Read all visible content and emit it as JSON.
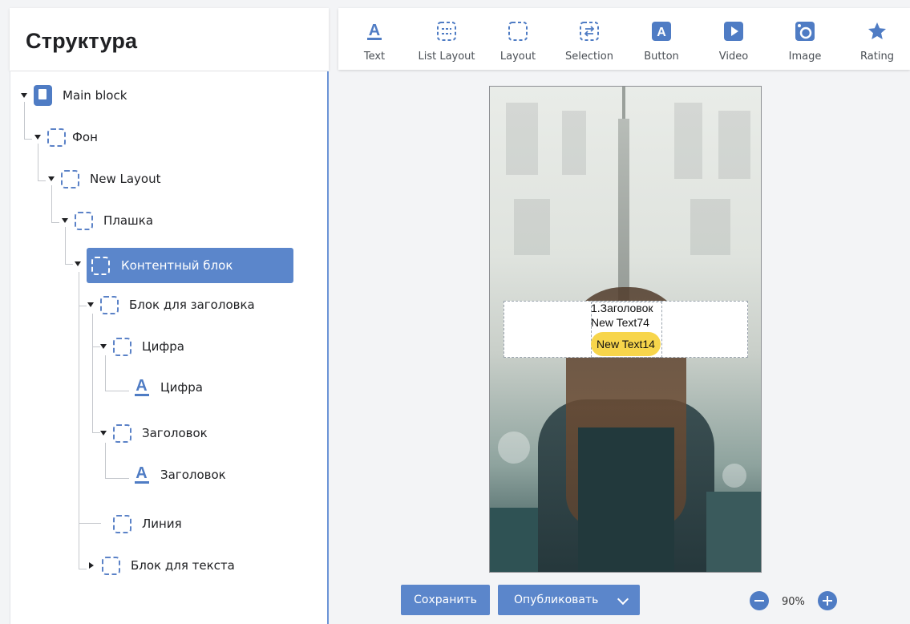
{
  "structure": {
    "title": "Структура",
    "nodes": [
      {
        "label": "Main block"
      },
      {
        "label": "Фон"
      },
      {
        "label": "New Layout"
      },
      {
        "label": "Плашка"
      },
      {
        "label": "Контентный блок"
      },
      {
        "label": "Блок для заголовка"
      },
      {
        "label": "Цифра"
      },
      {
        "label": "Цифра"
      },
      {
        "label": "Заголовок"
      },
      {
        "label": "Заголовок"
      },
      {
        "label": "Линия"
      },
      {
        "label": "Блок для текста"
      }
    ]
  },
  "toolbar": {
    "items": [
      {
        "label": "Text",
        "icon": "text-icon"
      },
      {
        "label": "List Layout",
        "icon": "list-layout-icon"
      },
      {
        "label": "Layout",
        "icon": "layout-icon"
      },
      {
        "label": "Selection",
        "icon": "selection-icon"
      },
      {
        "label": "Button",
        "icon": "button-icon"
      },
      {
        "label": "Video",
        "icon": "video-icon"
      },
      {
        "label": "Image",
        "icon": "image-icon"
      },
      {
        "label": "Rating",
        "icon": "star-icon"
      }
    ]
  },
  "canvas": {
    "heading": "1.Заголовок",
    "text": "New Text74",
    "button": "New Text14"
  },
  "footer": {
    "save": "Сохранить",
    "publish": "Опубликовать",
    "zoom": "90%"
  },
  "colors": {
    "accent": "#5b86cb",
    "button_yellow": "#f7d54b"
  }
}
